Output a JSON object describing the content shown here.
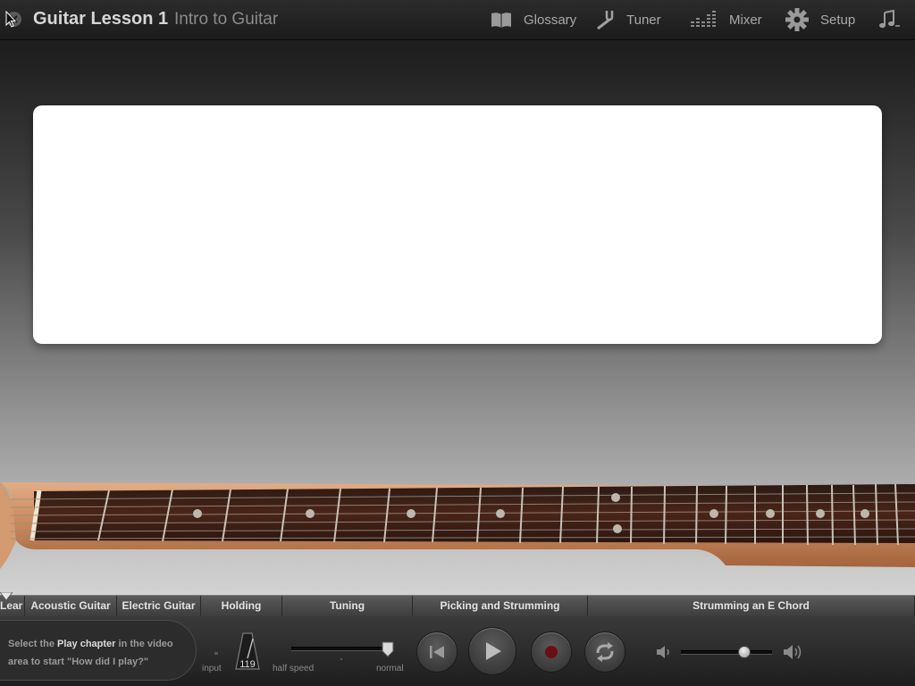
{
  "header": {
    "title": "Guitar Lesson 1",
    "subtitle": "Intro to Guitar",
    "nav": [
      {
        "label": "Glossary",
        "icon": "book-icon"
      },
      {
        "label": "Tuner",
        "icon": "tuning-fork-icon"
      },
      {
        "label": "Mixer",
        "icon": "mixer-icon"
      },
      {
        "label": "Setup",
        "icon": "gear-icon"
      }
    ]
  },
  "chapters": [
    "Lear",
    "Acoustic Guitar",
    "Electric Guitar",
    "Holding",
    "Tuning",
    "Picking and Strumming",
    "Strumming an E Chord"
  ],
  "controls": {
    "hint_prefix": "Select the ",
    "hint_bold": "Play chapter",
    "hint_suffix": " in the video area to start \"How did I play?\"",
    "input_label": "input",
    "tempo": "119",
    "half_speed_label": "half speed",
    "normal_label": "normal",
    "speed_value": 1.0,
    "volume_value": 0.7
  },
  "colors": {
    "record": "#6a0f14",
    "fretboard": "#3a1e14",
    "neck_wood": "#c8875c"
  }
}
